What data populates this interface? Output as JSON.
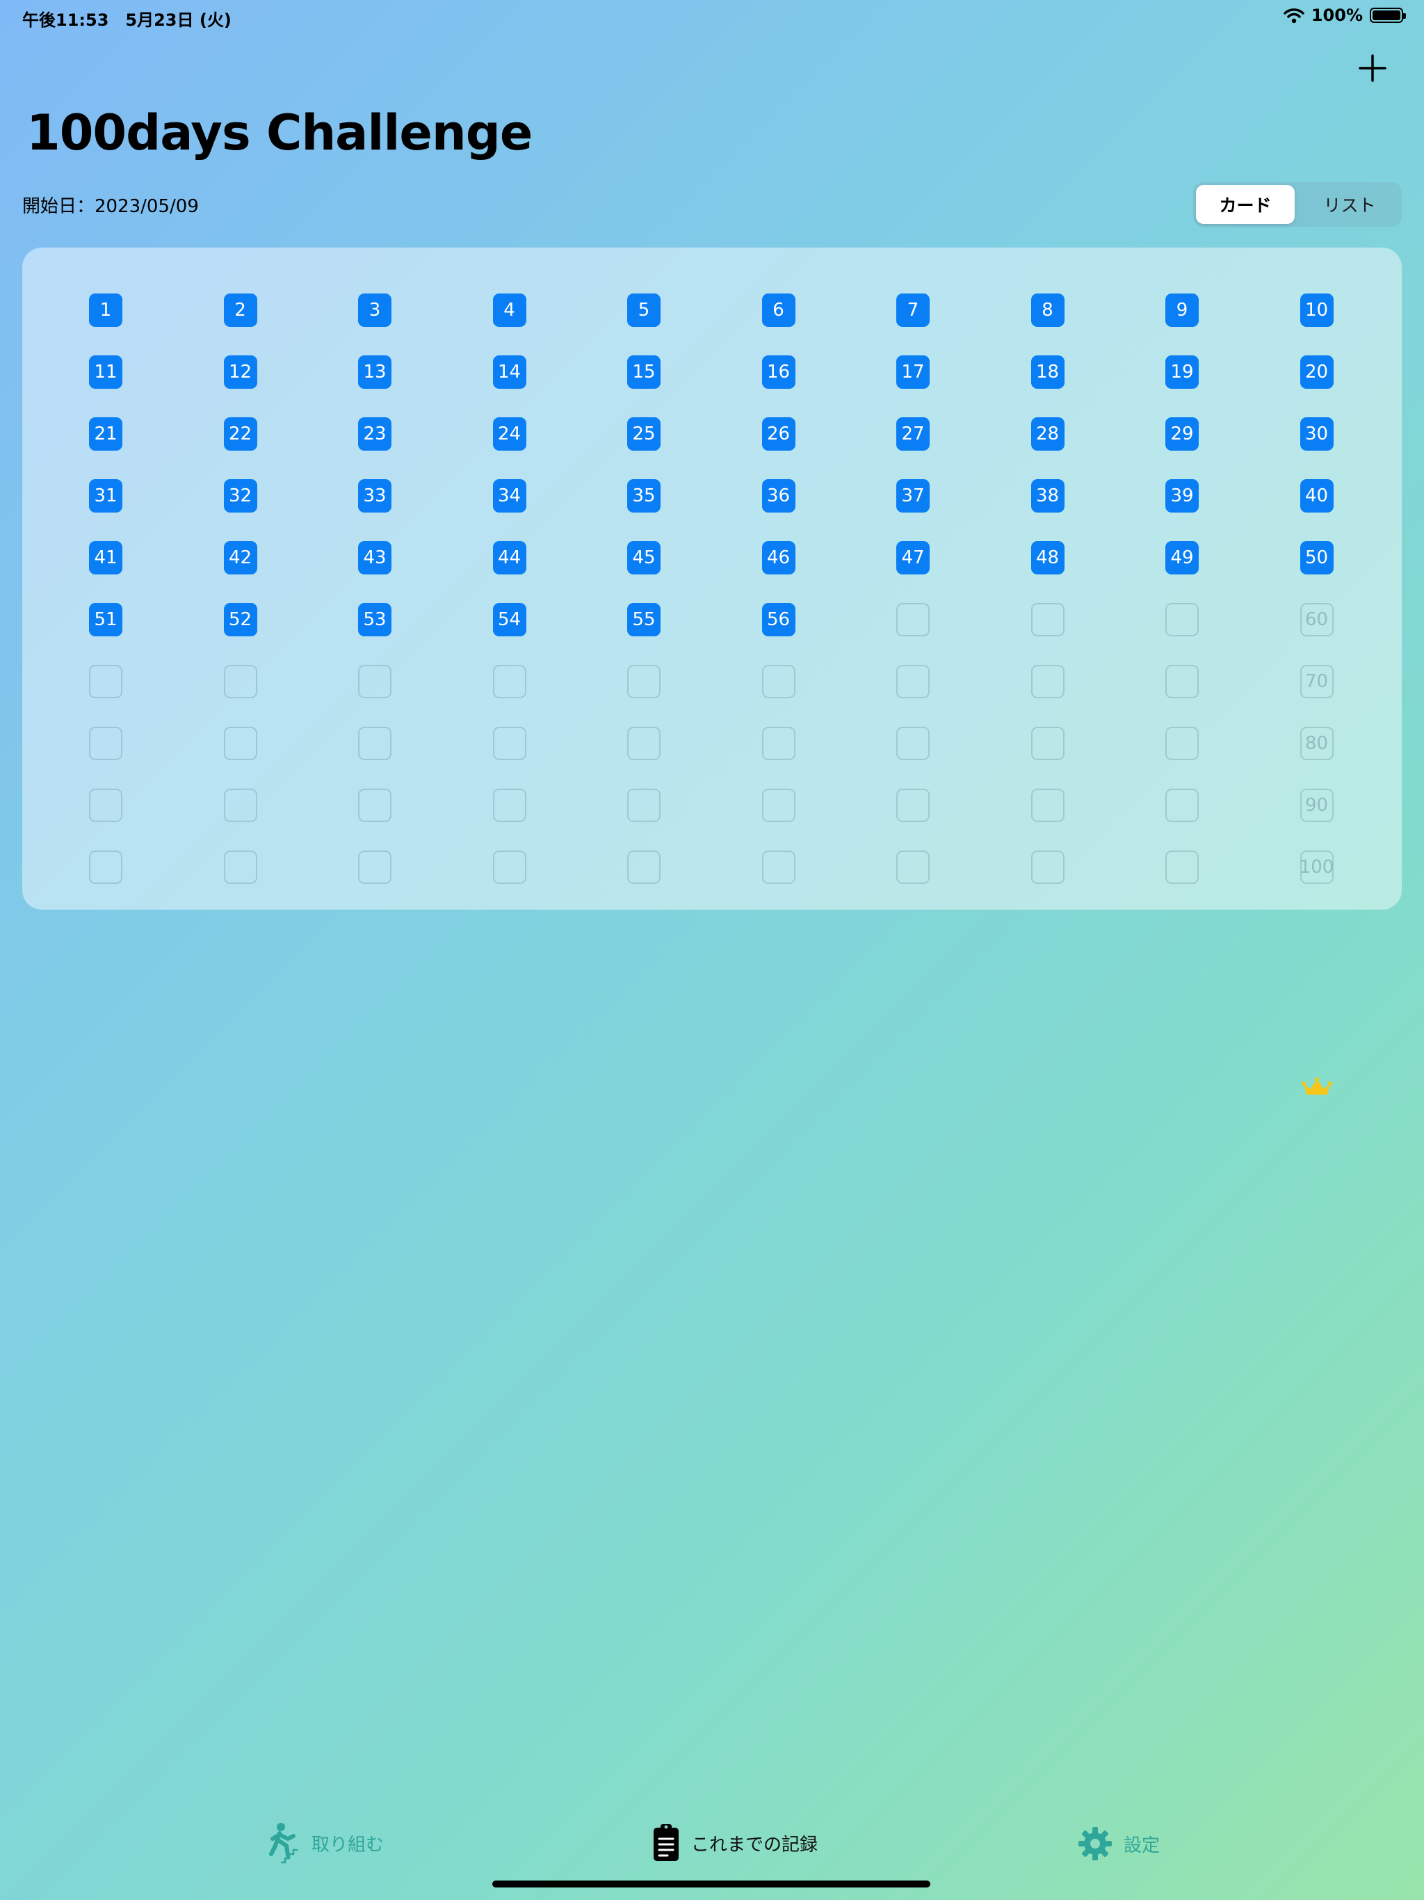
{
  "status": {
    "time": "午後11:53　5月23日 (火)",
    "battery": "100%"
  },
  "header": {
    "title": "100days Challenge",
    "start_date": "開始日：2023/05/09"
  },
  "segmented": {
    "options": [
      "カード",
      "リスト"
    ],
    "selected": "カード"
  },
  "grid": {
    "total_days": 100,
    "completed_days": 56,
    "labeled_remaining": [
      60,
      70,
      80,
      90,
      100
    ],
    "goal_icon": "crown-icon",
    "accent_color": "#0a7ef4"
  },
  "tabs": [
    {
      "label": "取り組む",
      "icon": "running-person-icon"
    },
    {
      "label": "これまでの記録",
      "icon": "clipboard-icon",
      "selected": true
    },
    {
      "label": "設定",
      "icon": "gear-icon"
    }
  ],
  "colors": {
    "tab_inactive": "#2fa69a",
    "crown": "#f5c518"
  }
}
